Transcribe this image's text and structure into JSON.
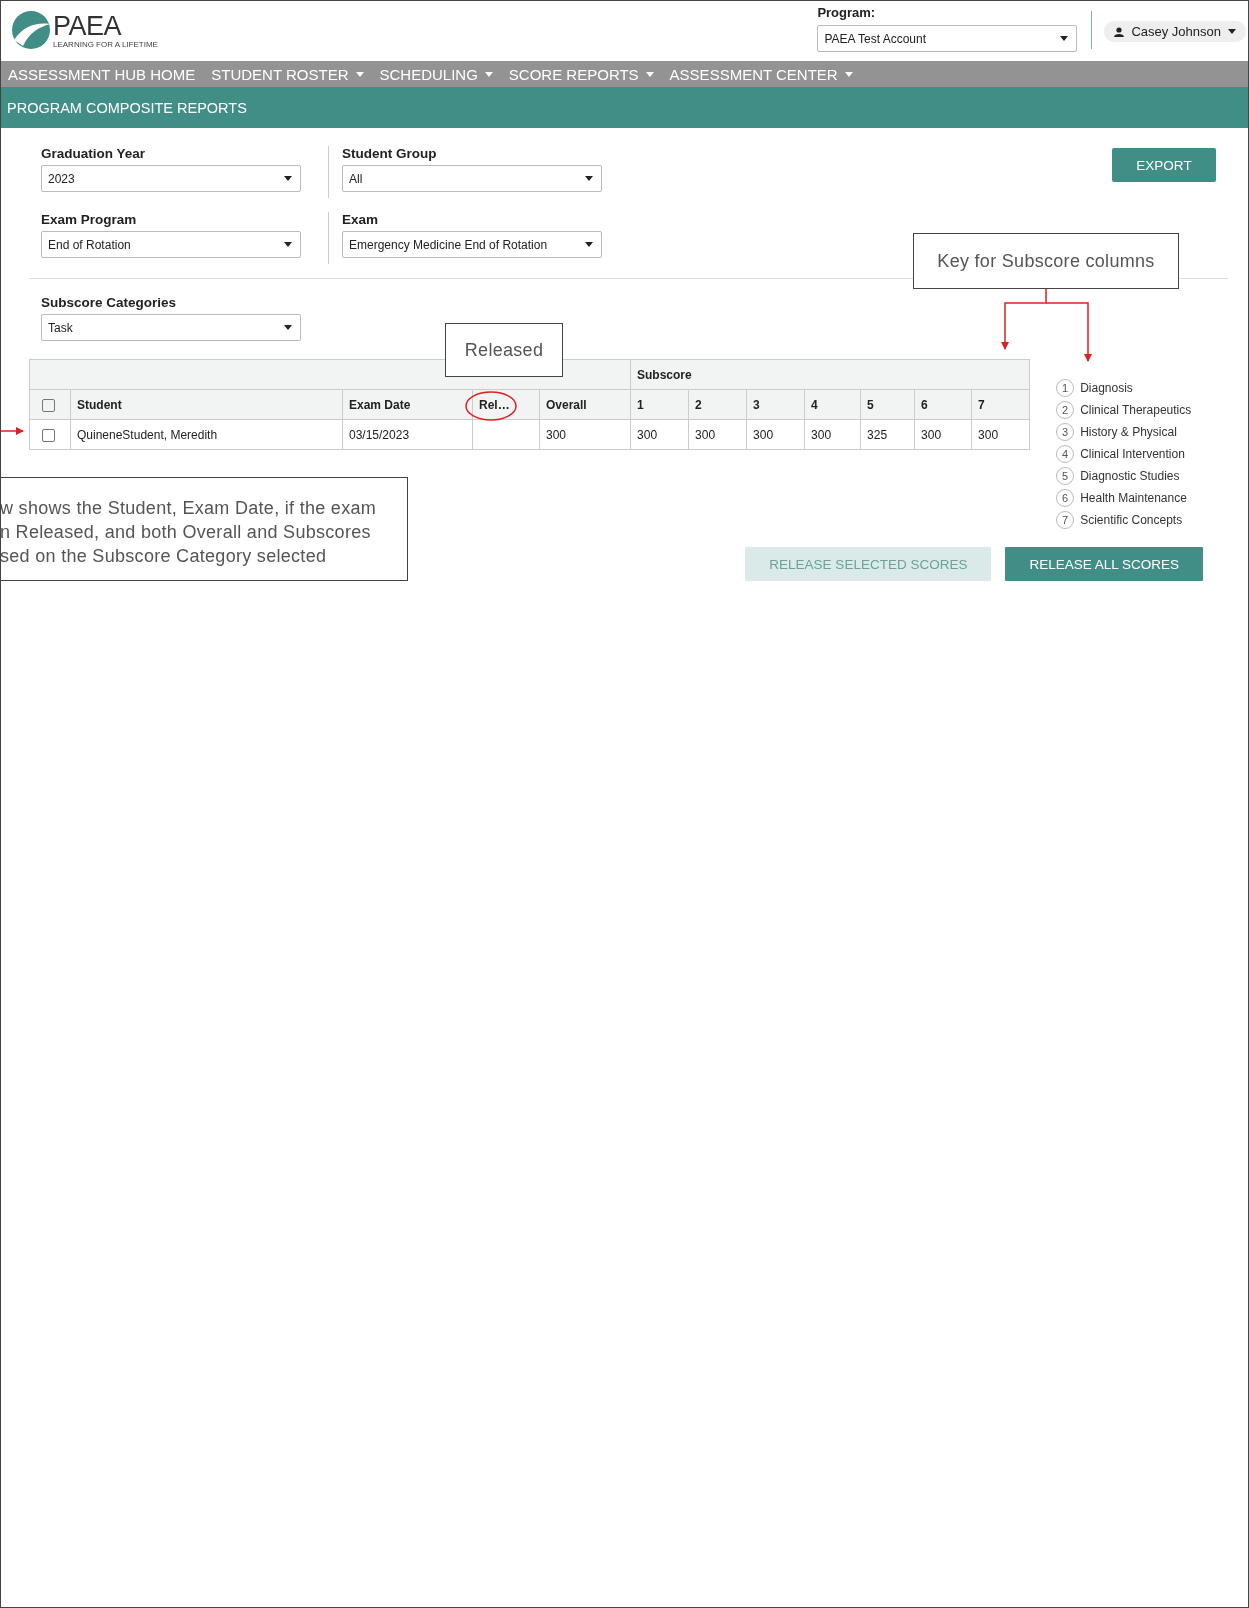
{
  "header": {
    "logo_text": "PAEA",
    "logo_tagline": "LEARNING FOR A LIFETIME",
    "program_label": "Program:",
    "program_value": "PAEA Test Account",
    "user_name": "Casey Johnson"
  },
  "nav": [
    {
      "label": "ASSESSMENT HUB HOME",
      "dropdown": false
    },
    {
      "label": "STUDENT ROSTER",
      "dropdown": true
    },
    {
      "label": "SCHEDULING",
      "dropdown": true
    },
    {
      "label": "SCORE REPORTS",
      "dropdown": true
    },
    {
      "label": "ASSESSMENT CENTER",
      "dropdown": true
    }
  ],
  "page_title": "PROGRAM COMPOSITE REPORTS",
  "filters": [
    {
      "label": "Graduation Year",
      "value": "2023"
    },
    {
      "label": "Student Group",
      "value": "All"
    },
    {
      "label": "Exam Program",
      "value": "End of Rotation"
    },
    {
      "label": "Exam",
      "value": "Emergency Medicine End of Rotation"
    }
  ],
  "export_button": "EXPORT",
  "subscore_filter": {
    "label": "Subscore Categories",
    "value": "Task"
  },
  "table": {
    "group_header": "Subscore",
    "select_all_checked": false,
    "columns": [
      "Student",
      "Exam Date",
      "Rel…",
      "Overall",
      "1",
      "2",
      "3",
      "4",
      "5",
      "6",
      "7"
    ],
    "rows": [
      {
        "checked": false,
        "cells": [
          "QuineneStudent, Meredith",
          "03/15/2023",
          "",
          "300",
          "300",
          "300",
          "300",
          "300",
          "325",
          "300",
          "300"
        ]
      }
    ]
  },
  "key": [
    {
      "number": "1",
      "label": "Diagnosis"
    },
    {
      "number": "2",
      "label": "Clinical Therapeutics"
    },
    {
      "number": "3",
      "label": "History & Physical"
    },
    {
      "number": "4",
      "label": "Clinical Intervention"
    },
    {
      "number": "5",
      "label": "Diagnostic Studies"
    },
    {
      "number": "6",
      "label": "Health Maintenance"
    },
    {
      "number": "7",
      "label": "Scientific Concepts"
    }
  ],
  "buttons": [
    {
      "label": "RELEASE SELECTED SCORES",
      "disabled": true
    },
    {
      "label": "RELEASE ALL SCORES",
      "disabled": false
    }
  ],
  "annotations": {
    "key_note": "Key for Subscore columns",
    "released_note": "Released",
    "row_note": [
      "w shows the Student, Exam Date, if the exam",
      "n Released, and both Overall and Subscores",
      "sed on the Subscore Category selected"
    ]
  }
}
